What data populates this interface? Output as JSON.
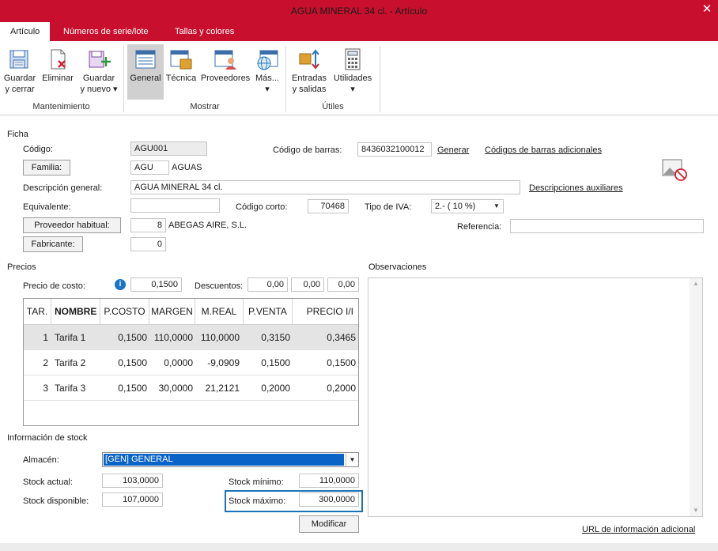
{
  "window": {
    "title": "AGUA MINERAL 34 cl. - Artículo",
    "close_glyph": "✕"
  },
  "tabs": [
    "Artículo",
    "Números de serie/lote",
    "Tallas y colores"
  ],
  "ribbon": {
    "groups": {
      "mantenimiento": "Mantenimiento",
      "mostrar": "Mostrar",
      "utiles": "Útiles"
    },
    "buttons": {
      "guardar_cerrar": [
        "Guardar",
        "y cerrar"
      ],
      "eliminar": "Eliminar",
      "guardar_nuevo": [
        "Guardar",
        "y nuevo ▾"
      ],
      "general": "General",
      "tecnica": "Técnica",
      "proveedores": "Proveedores",
      "mas": "Más...",
      "mas_arrow": "▾",
      "entradas": [
        "Entradas",
        "y salidas"
      ],
      "utilidades": "Utilidades",
      "utilidades_arrow": "▾"
    }
  },
  "ficha": {
    "section": "Ficha",
    "codigo_label": "Código:",
    "codigo": "AGU001",
    "familia_btn": "Familia:",
    "familia_code": "AGU",
    "familia_name": "AGUAS",
    "descripcion_label": "Descripción general:",
    "descripcion": "AGUA MINERAL 34 cl.",
    "equivalente_label": "Equivalente:",
    "equivalente": "",
    "codigo_corto_label": "Código corto:",
    "codigo_corto": "70468",
    "tipo_iva_label": "Tipo de IVA:",
    "tipo_iva": "2.- ( 10 %)",
    "proveedor_btn": "Proveedor habitual:",
    "proveedor_code": "8",
    "proveedor_name": "ABEGAS AIRE, S.L.",
    "referencia_label": "Referencia:",
    "referencia": "",
    "fabricante_btn": "Fabricante:",
    "fabricante": "0",
    "codigo_barras_label": "Código de barras:",
    "codigo_barras": "8436032100012",
    "generar_link": "Generar",
    "codigos_adicionales_link": "Códigos de barras adicionales",
    "descripciones_aux_link": "Descripciones auxiliares"
  },
  "precios": {
    "section": "Precios",
    "precio_costo_label": "Precio de costo:",
    "precio_costo": "0,1500",
    "descuentos_label": "Descuentos:",
    "descuentos": [
      "0,00",
      "0,00",
      "0,00"
    ],
    "columns": [
      "TAR.",
      "NOMBRE",
      "P.COSTO",
      "MARGEN",
      "M.REAL",
      "P.VENTA",
      "PRECIO I/I"
    ],
    "rows": [
      [
        "1",
        "Tarifa 1",
        "0,1500",
        "110,0000",
        "110,0000",
        "0,3150",
        "0,3465"
      ],
      [
        "2",
        "Tarifa 2",
        "0,1500",
        "0,0000",
        "-9,0909",
        "0,1500",
        "0,1500"
      ],
      [
        "3",
        "Tarifa 3",
        "0,1500",
        "30,0000",
        "21,2121",
        "0,2000",
        "0,2000"
      ]
    ]
  },
  "stock": {
    "section": "Información de stock",
    "almacen_label": "Almacén:",
    "almacen": "[GEN] GENERAL",
    "stock_actual_label": "Stock actual:",
    "stock_actual": "103,0000",
    "stock_disponible_label": "Stock disponible:",
    "stock_disponible": "107,0000",
    "stock_minimo_label": "Stock mínimo:",
    "stock_minimo": "110,0000",
    "stock_maximo_label": "Stock máximo:",
    "stock_maximo": "300,0000",
    "modificar_btn": "Modificar"
  },
  "observaciones": {
    "label": "Observaciones",
    "text": ""
  },
  "url_link": "URL de información adicional",
  "colors": {
    "accent": "#c8102e",
    "selection": "#0a64c8",
    "highlight_border": "#1a73b8"
  }
}
